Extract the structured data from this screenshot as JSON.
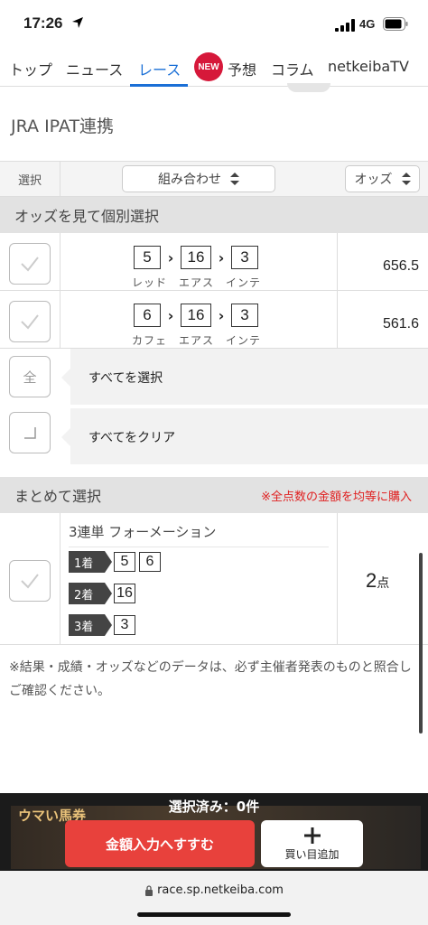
{
  "status_bar": {
    "time": "17:26",
    "network": "4G"
  },
  "nav": {
    "tabs": [
      {
        "label": "トップ"
      },
      {
        "label": "ニュース"
      },
      {
        "label": "レース"
      },
      {
        "label": "予想"
      },
      {
        "label": "コラム"
      },
      {
        "label": "netkeibaTV"
      }
    ],
    "active_tab": "レース",
    "new_badge": "NEW"
  },
  "section": {
    "title": "JRA IPAT連携"
  },
  "table_header": {
    "select_label": "選択",
    "combination_label": "組み合わせ",
    "odds_label": "オッズ"
  },
  "individual": {
    "band_label": "オッズを見て個別選択",
    "rows": [
      {
        "nums": [
          "5",
          "16",
          "3"
        ],
        "names": [
          "レッド",
          "エアス",
          "インテ"
        ],
        "odds": "656.5"
      },
      {
        "nums": [
          "6",
          "16",
          "3"
        ],
        "names": [
          "カフェ",
          "エアス",
          "インテ"
        ],
        "odds": "561.6"
      }
    ],
    "select_all_icon": "全",
    "select_all_label": "すべてを選択",
    "clear_all_label": "すべてをクリア"
  },
  "bulk": {
    "band_label": "まとめて選択",
    "note": "※全点数の金額を均等に購入",
    "formation_title": "3連単 フォーメーション",
    "places": [
      {
        "label": "1着",
        "nums": [
          "5",
          "6"
        ]
      },
      {
        "label": "2着",
        "nums": [
          "16"
        ]
      },
      {
        "label": "3着",
        "nums": [
          "3"
        ]
      }
    ],
    "count": "2",
    "count_unit": "点"
  },
  "disclaimer": "※結果・成績・オッズなどのデータは、必ず主催者発表のものと照合しご確認ください。",
  "bottom_bar": {
    "banner_text": "ウマい馬券",
    "selected_text": "選択済み：0件",
    "primary_button": "金額入力へすすむ",
    "secondary_button": "買い目追加"
  },
  "browser": {
    "url": "race.sp.netkeiba.com"
  },
  "colors": {
    "accent": "#1a6fd6",
    "primary_button": "#e8413c",
    "warning": "#e02020",
    "new_badge": "#d6183a"
  }
}
